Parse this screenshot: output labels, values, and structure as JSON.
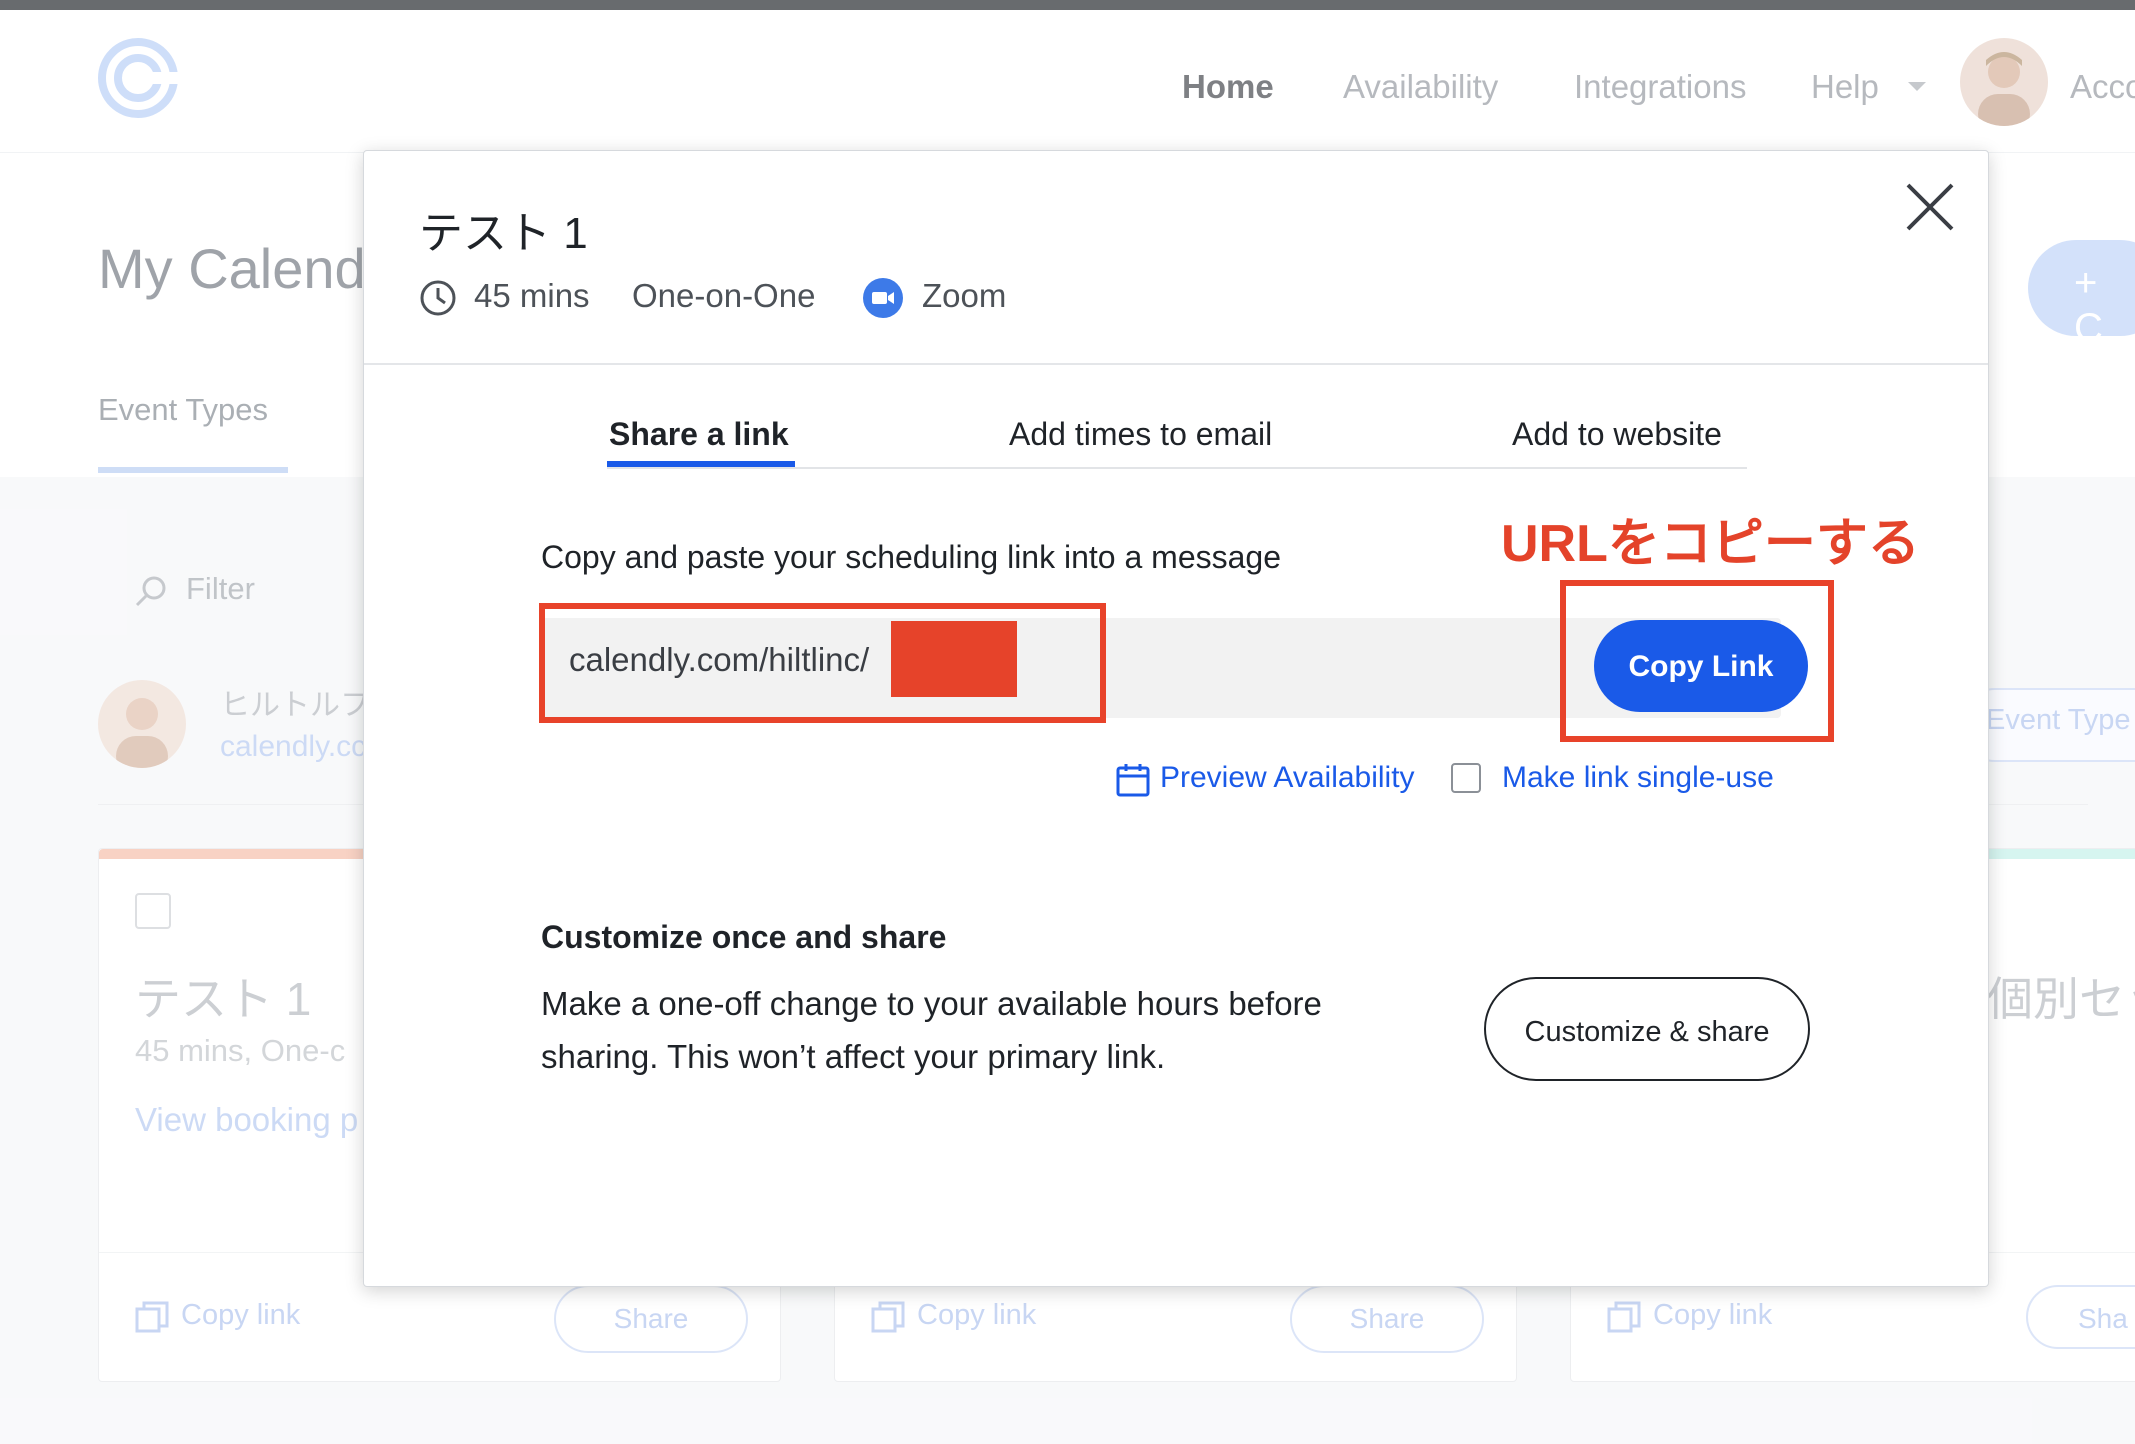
{
  "nav": {
    "items": [
      {
        "label": "Home"
      },
      {
        "label": "Availability"
      },
      {
        "label": "Integrations"
      },
      {
        "label": "Help"
      },
      {
        "label": "Acco"
      }
    ]
  },
  "background": {
    "page_title": "My Calend",
    "tab_event_types": "Event Types",
    "filter_placeholder": "Filter",
    "user_name": "ヒルトルフ",
    "user_link": "calendly.cc",
    "right_button": "Event Type",
    "right_card_title": "個別セッ",
    "card1": {
      "title": "テスト 1",
      "subtitle": "45 mins, One-c",
      "link": "View booking p"
    },
    "footer_copy_link": "Copy link",
    "footer_share": "Share",
    "footer_share_partial": "Sha",
    "create_plus": "+ C"
  },
  "modal": {
    "title": "テスト 1",
    "duration": "45 mins",
    "event_kind": "One-on-One",
    "location": "Zoom",
    "tabs": [
      {
        "label": "Share a link",
        "active": true
      },
      {
        "label": "Add times to email",
        "active": false
      },
      {
        "label": "Add to website",
        "active": false
      }
    ],
    "instructions": "Copy and paste your scheduling link into a message",
    "link_value": "calendly.com/hiltlinc/",
    "copy_button": "Copy Link",
    "preview_availability": "Preview Availability",
    "single_use_label": "Make link single-use",
    "single_use_checked": false,
    "customize_heading": "Customize once and share",
    "customize_body": "Make a one-off change to your available hours before sharing. This won’t affect your primary link.",
    "customize_button": "Customize & share"
  },
  "annotation": {
    "text": "URLをコピーする",
    "color": "#e4432a"
  },
  "colors": {
    "accent": "#1a5ae8",
    "annotation_red": "#e8432a",
    "card1_strip": "#f5c1ad",
    "card3_strip": "#c7f2ea"
  }
}
